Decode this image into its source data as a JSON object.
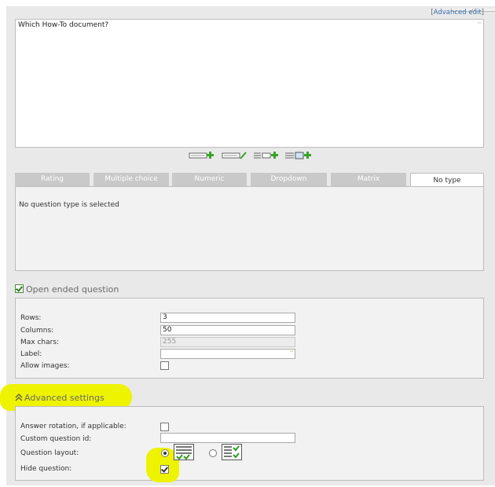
{
  "advanced_edit": {
    "open": "[",
    "label": "Advanced edit",
    "close": "]"
  },
  "question_text": "Which How-To document?",
  "question_resize": "···",
  "toolbar": {
    "tools": [
      "add-line-icon",
      "edit-line-icon",
      "add-list-icon",
      "add-image-icon"
    ]
  },
  "type_tabs": [
    {
      "label": "Rating",
      "active": false
    },
    {
      "label": "Multiple choice",
      "active": false
    },
    {
      "label": "Numeric",
      "active": false
    },
    {
      "label": "Dropdown",
      "active": false
    },
    {
      "label": "Matrix",
      "active": false
    },
    {
      "label": "No type",
      "active": true
    }
  ],
  "type_message": "No question type is selected",
  "open_ended": {
    "title": "Open ended question",
    "checked": true,
    "fields": {
      "rows_label": "Rows:",
      "rows_value": "3",
      "columns_label": "Columns:",
      "columns_value": "50",
      "maxchars_label": "Max chars:",
      "maxchars_value": "255",
      "label_label": "Label:",
      "label_value": "",
      "label_resize": "···",
      "allow_images_label": "Allow images:",
      "allow_images_checked": false
    }
  },
  "advanced": {
    "title": "Advanced settings",
    "collapse_icon": "double-chevron-up-icon",
    "answer_rotation_label": "Answer rotation, if applicable:",
    "answer_rotation_checked": false,
    "custom_id_label": "Custom question id:",
    "custom_id_value": "",
    "layout_label": "Question layout:",
    "layout_selected": "horizontal",
    "hide_label": "Hide question:",
    "hide_checked": true
  },
  "colors": {
    "highlight": "#eef300",
    "accent_green": "#4b8b3b",
    "link": "#3a6fb0"
  }
}
